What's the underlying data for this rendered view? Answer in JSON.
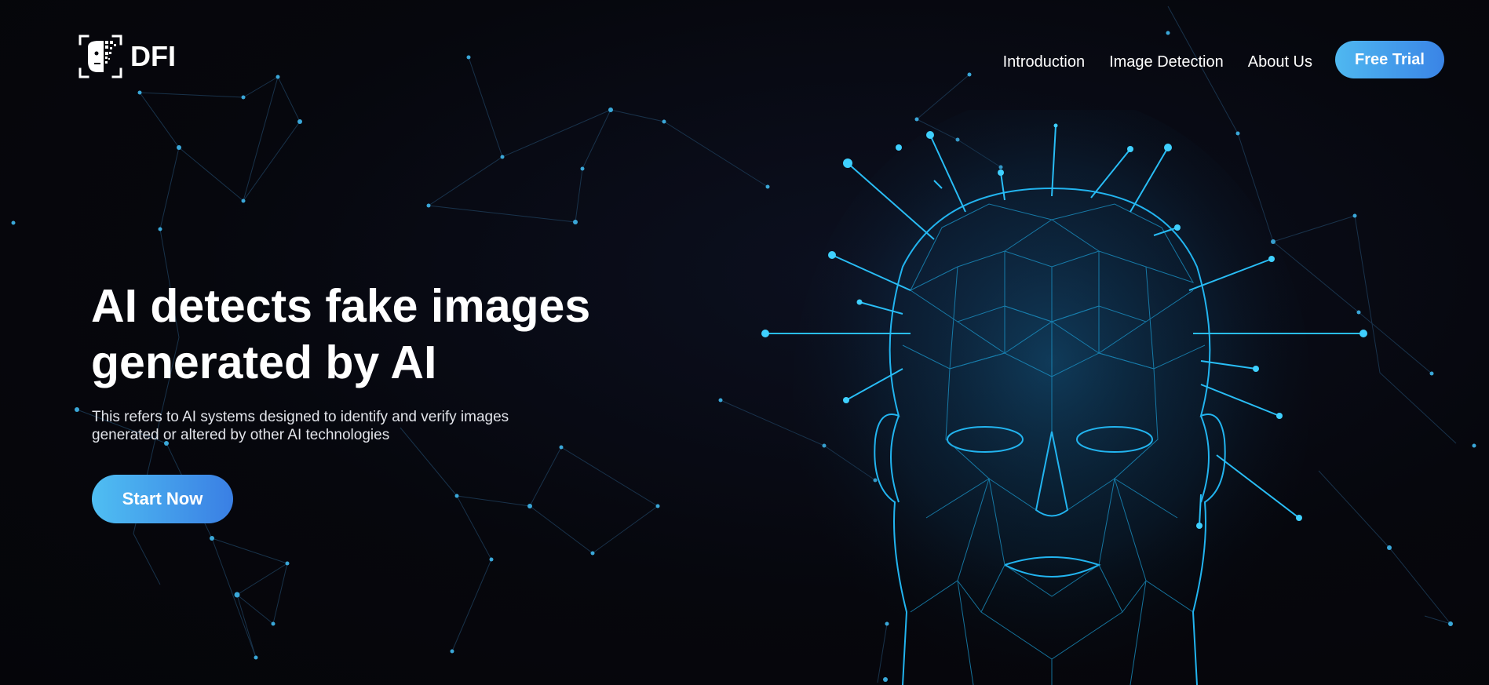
{
  "brand": {
    "logo_text": "DFI",
    "logo_icon": "face-scan-icon"
  },
  "nav": {
    "items": [
      {
        "label": "Introduction"
      },
      {
        "label": "Image Detection"
      },
      {
        "label": "About Us"
      }
    ],
    "cta_label": "Free Trial"
  },
  "hero": {
    "title": "AI detects fake images generated by AI",
    "subtitle": "This refers to AI systems designed to identify and verify images generated or altered by other AI technologies",
    "cta_label": "Start Now",
    "illustration": "wireframe-head-icon"
  },
  "colors": {
    "background": "#07080f",
    "accent_start": "#4fb8f0",
    "accent_end": "#3a84e6",
    "wireframe": "#1ea7e0",
    "network_lines": "#1c3a55"
  }
}
